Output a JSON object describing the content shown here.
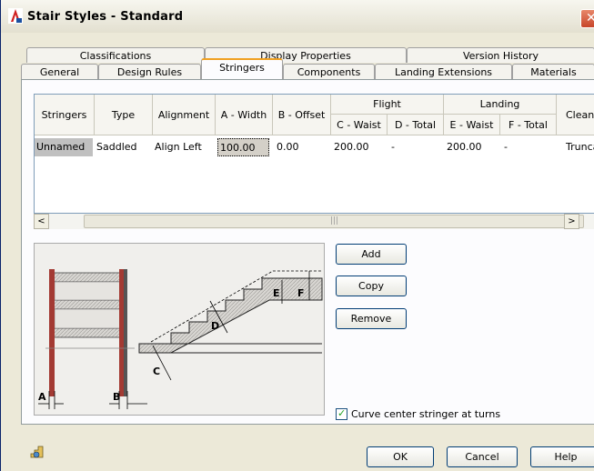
{
  "window": {
    "title": "Stair Styles - Standard",
    "close_glyph": "✕"
  },
  "tabs_back": [
    {
      "label": "Classifications"
    },
    {
      "label": "Display Properties"
    },
    {
      "label": "Version History"
    }
  ],
  "tabs_front": [
    {
      "label": "General"
    },
    {
      "label": "Design Rules"
    },
    {
      "label": "Stringers"
    },
    {
      "label": "Components"
    },
    {
      "label": "Landing Extensions"
    },
    {
      "label": "Materials"
    }
  ],
  "active_tab": "Stringers",
  "grid": {
    "headers": {
      "stringers": "Stringers",
      "type": "Type",
      "alignment": "Alignment",
      "a_width": "A - Width",
      "b_offset": "B - Offset",
      "flight": "Flight",
      "c_waist": "C - Waist",
      "d_total": "D - Total",
      "landing": "Landing",
      "e_waist": "E - Waist",
      "f_total": "F - Total",
      "clean": "Clean"
    },
    "row": {
      "stringers": "Unnamed",
      "type": "Saddled",
      "alignment": "Align Left",
      "a_width": "100.00",
      "b_offset": "0.00",
      "c_waist": "200.00",
      "d_total": "-",
      "e_waist": "200.00",
      "f_total": "-",
      "clean": "Trunca"
    }
  },
  "scroll": {
    "left_arrow": "<",
    "right_arrow": ">",
    "grip": "|||"
  },
  "diagram_labels": {
    "a": "A",
    "b": "B",
    "c": "C",
    "d": "D",
    "e": "E",
    "f": "F"
  },
  "buttons": {
    "add": "Add",
    "copy": "Copy",
    "remove": "Remove",
    "ok": "OK",
    "cancel": "Cancel",
    "help": "Help"
  },
  "options": {
    "curve_center_stringer_label": "Curve center stringer at turns",
    "curve_center_stringer_checked": true,
    "check_glyph": "✓"
  },
  "icons": {
    "app": "autocad-app-icon",
    "close": "close-icon",
    "bottom": "stair-style-icon"
  }
}
